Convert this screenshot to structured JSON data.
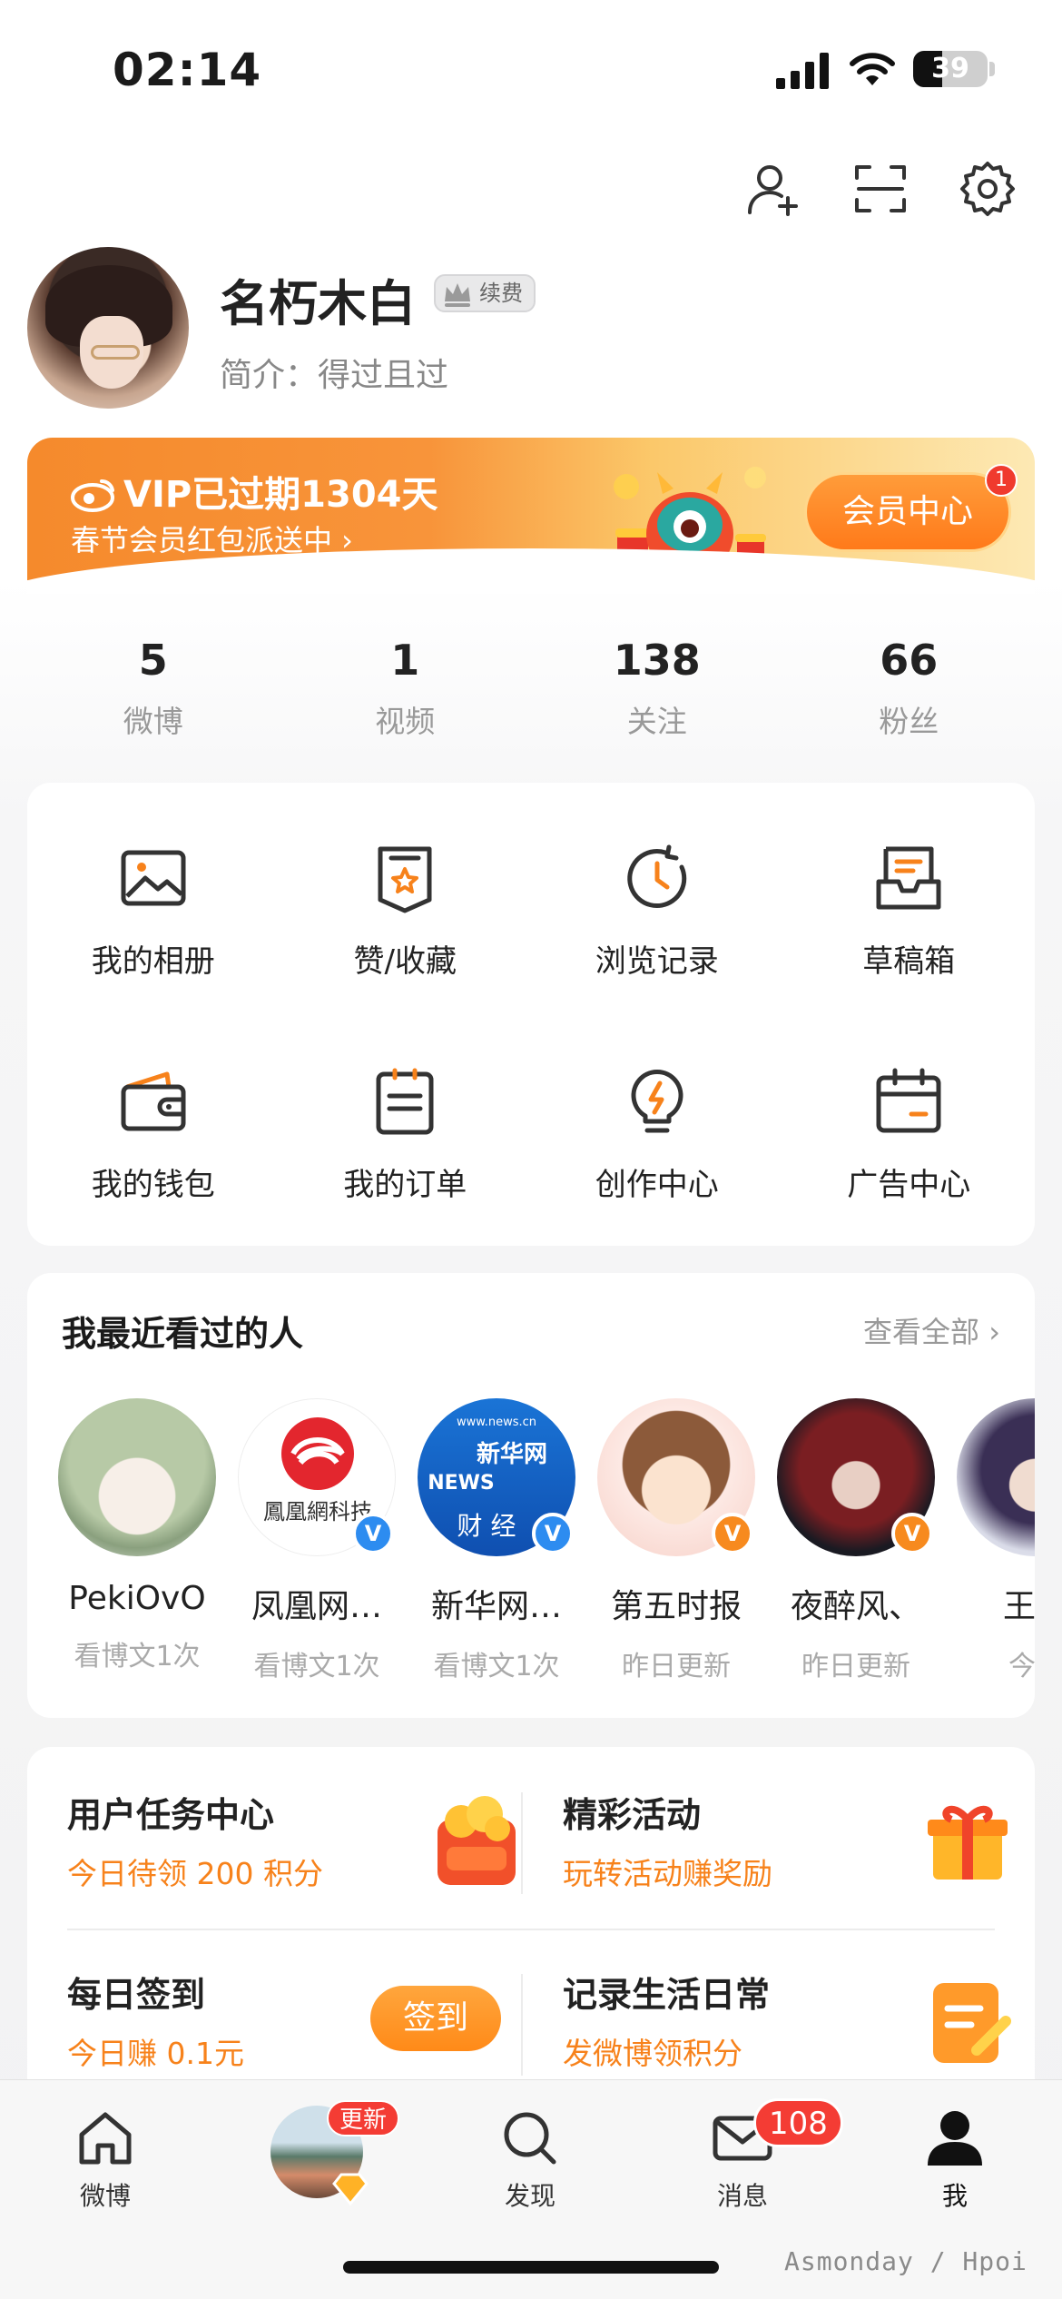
{
  "status_bar": {
    "time": "02:14",
    "battery": "39",
    "battery_level": 0.39
  },
  "profile": {
    "name": "名朽木白",
    "renew_badge": "续费",
    "bio": "简介：得过且过"
  },
  "vip_banner": {
    "title": "VIP已过期1304天",
    "subtitle": "春节会员红包派送中 ›",
    "button": "会员中心",
    "button_badge": "1"
  },
  "stats": [
    {
      "num": "5",
      "label": "微博"
    },
    {
      "num": "1",
      "label": "视频"
    },
    {
      "num": "138",
      "label": "关注"
    },
    {
      "num": "66",
      "label": "粉丝"
    }
  ],
  "grid": [
    {
      "label": "我的相册",
      "icon": "photo-album-icon"
    },
    {
      "label": "赞/收藏",
      "icon": "favorite-icon"
    },
    {
      "label": "浏览记录",
      "icon": "history-icon"
    },
    {
      "label": "草稿箱",
      "icon": "drafts-icon"
    },
    {
      "label": "我的钱包",
      "icon": "wallet-icon"
    },
    {
      "label": "我的订单",
      "icon": "orders-icon"
    },
    {
      "label": "创作中心",
      "icon": "creator-bulb-icon"
    },
    {
      "label": "广告中心",
      "icon": "ad-calendar-icon"
    }
  ],
  "recent": {
    "title": "我最近看过的人",
    "more": "查看全部 ›",
    "people": [
      {
        "name": "PekiOvO",
        "sub": "看博文1次",
        "badge": ""
      },
      {
        "name": "凤凰网…",
        "sub": "看博文1次",
        "badge": "V",
        "logo_text": "鳳凰網科技"
      },
      {
        "name": "新华网…",
        "sub": "看博文1次",
        "badge": "V",
        "logo_text": "新华网",
        "logo_sub": "财 经",
        "logo_top": "www.news.cn",
        "logo_mid": "NEWS"
      },
      {
        "name": "第五时报",
        "sub": "昨日更新",
        "badge": "V"
      },
      {
        "name": "夜醉风、",
        "sub": "昨日更新",
        "badge": "V"
      },
      {
        "name": "王者",
        "sub": "今日",
        "badge": ""
      }
    ]
  },
  "tasks": {
    "task_center": {
      "title": "用户任务中心",
      "sub": "今日待领 200 积分"
    },
    "events": {
      "title": "精彩活动",
      "sub": "玩转活动赚奖励"
    },
    "checkin": {
      "title": "每日签到",
      "sub": "今日赚 0.1元",
      "button": "签到"
    },
    "life": {
      "title": "记录生活日常",
      "sub": "发微博领积分"
    }
  },
  "tabbar": {
    "home": "微博",
    "video_badge": "更新",
    "discover": "发现",
    "messages": "消息",
    "messages_badge": "108",
    "me": "我"
  },
  "watermark": "Asmonday / Hpoi",
  "colors": {
    "accent": "#f7821b",
    "vip_orange": "#f58a2c",
    "badge_red": "#f43c34",
    "verified_blue": "#2d8cf0"
  }
}
